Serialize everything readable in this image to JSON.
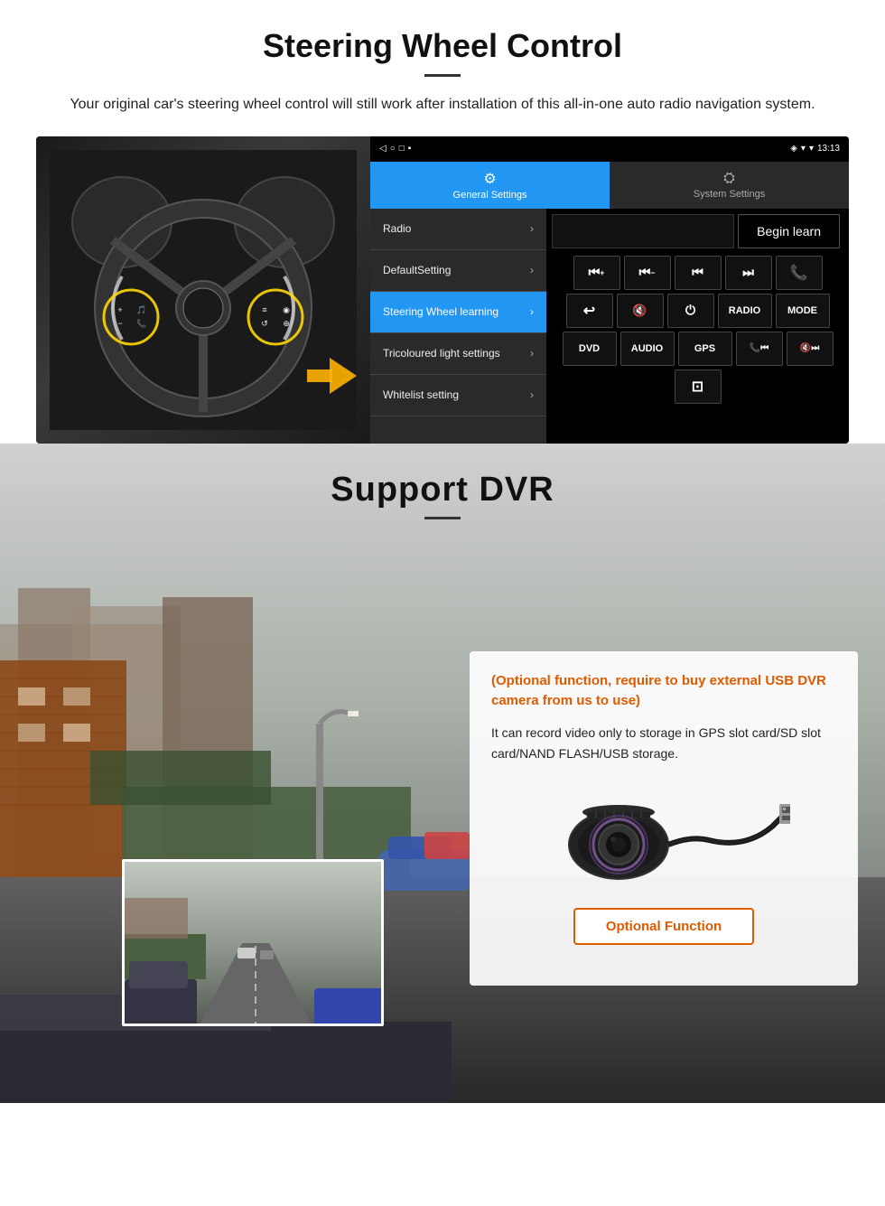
{
  "steering": {
    "title": "Steering Wheel Control",
    "subtitle": "Your original car's steering wheel control will still work after installation of this all-in-one auto radio navigation system.",
    "statusbar": {
      "time": "13:13",
      "signal": "▼",
      "wifi": "▾"
    },
    "tabs": {
      "general": "General Settings",
      "system": "System Settings"
    },
    "menu": {
      "items": [
        {
          "label": "Radio",
          "active": false
        },
        {
          "label": "DefaultSetting",
          "active": false
        },
        {
          "label": "Steering Wheel learning",
          "active": true
        },
        {
          "label": "Tricoloured light settings",
          "active": false
        },
        {
          "label": "Whitelist setting",
          "active": false
        }
      ]
    },
    "begin_learn": "Begin learn",
    "controls": {
      "row1": [
        "⏮+",
        "⏮-",
        "⏮",
        "⏭",
        "📞"
      ],
      "row2": [
        "↩",
        "🔇",
        "⏻",
        "RADIO",
        "MODE"
      ],
      "row3": [
        "DVD",
        "AUDIO",
        "GPS",
        "📞⏮",
        "🔇⏭"
      ],
      "row4": [
        "⊡"
      ]
    }
  },
  "dvr": {
    "title": "Support DVR",
    "optional_heading": "(Optional function, require to buy external USB DVR camera from us to use)",
    "description": "It can record video only to storage in GPS slot card/SD slot card/NAND FLASH/USB storage.",
    "optional_btn": "Optional Function"
  }
}
